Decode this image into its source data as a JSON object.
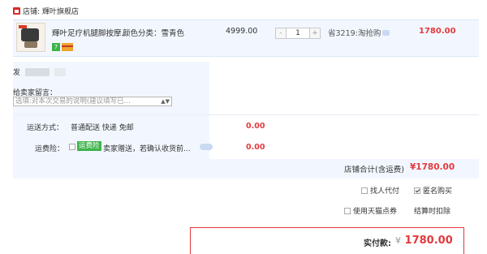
{
  "shop": {
    "label": "店铺:",
    "name": "輝叶旗舰店"
  },
  "product": {
    "title": "輝叶足疗机腿脚按摩...",
    "spec": "颜色分类：雪青色",
    "badge_seven": "7",
    "unit_price": "4999.00",
    "quantity": "1",
    "qty_minus": "-",
    "qty_plus": "+",
    "discount": "省3219:淘抢购",
    "total": "1780.00"
  },
  "delivery": {
    "sender_prefix": "发"
  },
  "message": {
    "label": "给卖家留言：",
    "placeholder": "选填:对本次交易的说明(建议填写已...",
    "arrow": "▲▼"
  },
  "shipping": {
    "label": "运送方式：",
    "value": "普通配送 快递 免邮",
    "price": "0.00"
  },
  "insurance": {
    "label": "运费险：",
    "badge": "运费险",
    "text": "卖家赠送，若确认收货前...",
    "price": "0.00"
  },
  "shop_total": {
    "label": "店铺合计(含运费)",
    "value": "¥1780.00"
  },
  "options": {
    "friend_pay": "找人代付",
    "anonymous": "匿名购买",
    "use_points": "使用天猫点券",
    "deduct_on_settle": "结算时扣除"
  },
  "payment": {
    "label": "实付款:",
    "currency": "¥",
    "amount": "1780.00"
  },
  "colors": {
    "accent_red": "#e4393c",
    "panel_blue": "#f2f7ff",
    "badge_green": "#3eb34a"
  }
}
